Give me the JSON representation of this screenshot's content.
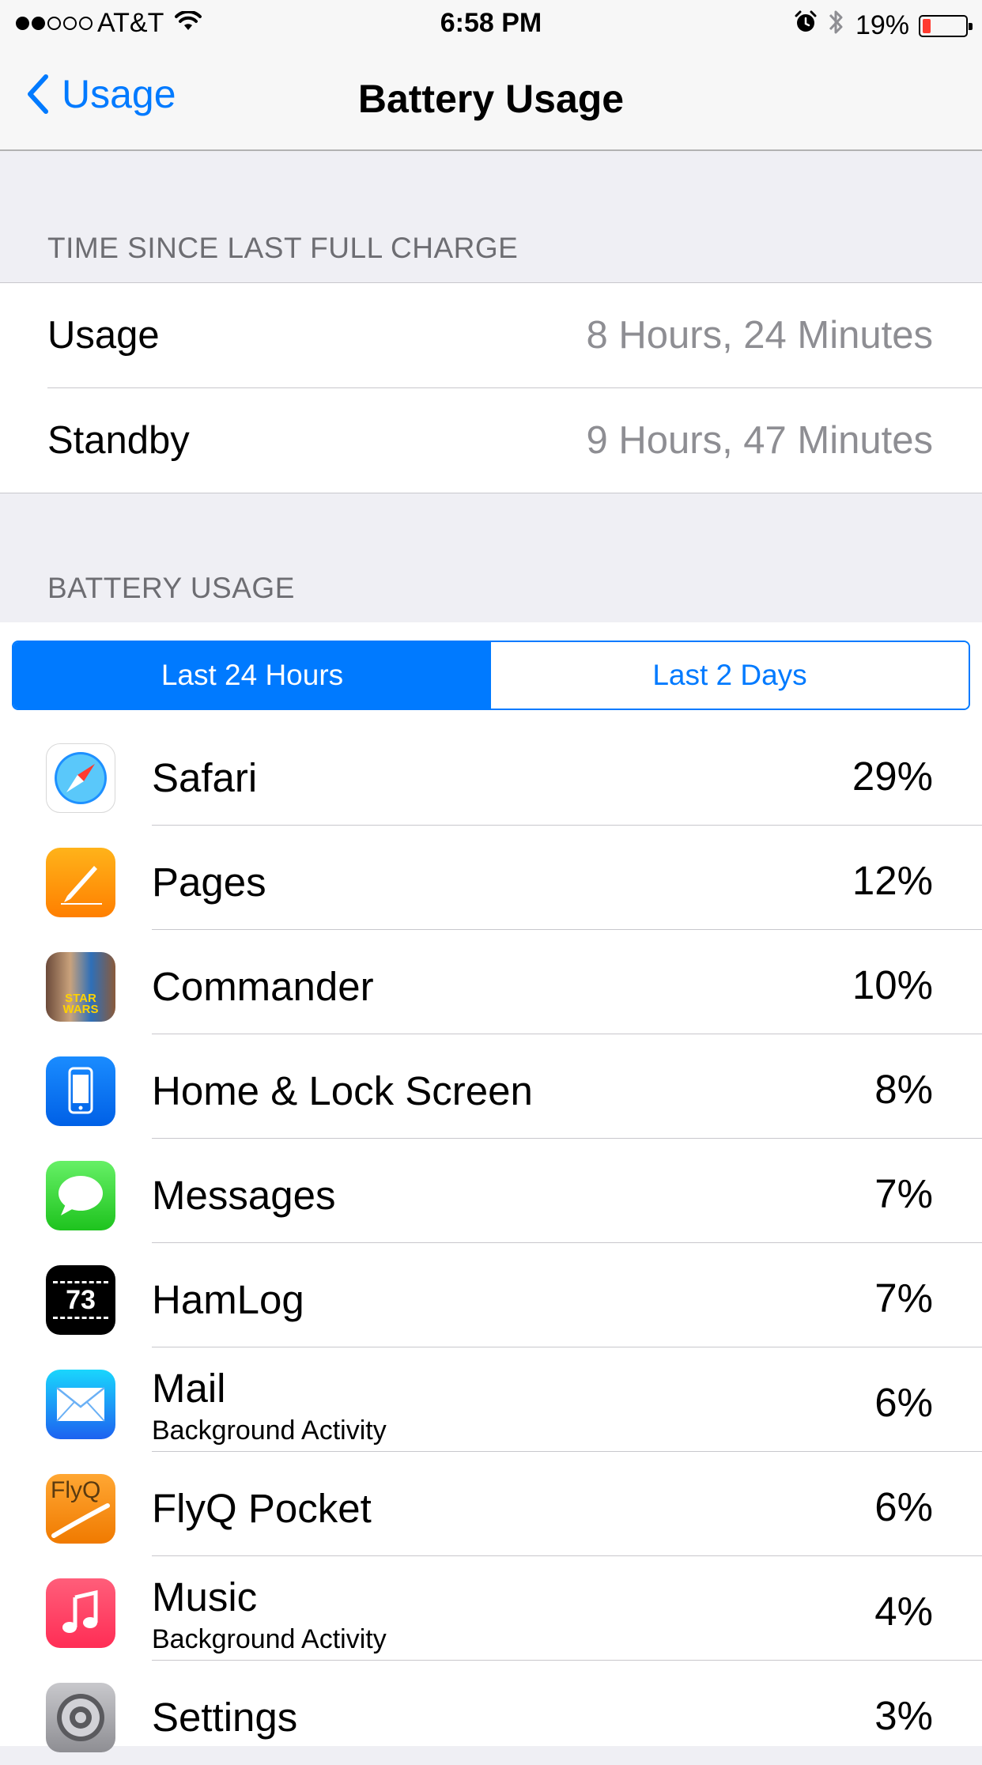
{
  "status_bar": {
    "signal": "●●○○○",
    "carrier": "AT&T",
    "time": "6:58 PM",
    "battery_percent": "19%",
    "icons": [
      "wifi-icon",
      "alarm-icon",
      "bluetooth-icon",
      "battery-icon"
    ]
  },
  "nav": {
    "back_label": "Usage",
    "title": "Battery Usage"
  },
  "time_section": {
    "header": "TIME SINCE LAST FULL CHARGE",
    "rows": [
      {
        "label": "Usage",
        "value": "8 Hours, 24 Minutes"
      },
      {
        "label": "Standby",
        "value": "9 Hours, 47 Minutes"
      }
    ]
  },
  "usage_section": {
    "header": "BATTERY USAGE",
    "segments": [
      "Last 24 Hours",
      "Last 2 Days"
    ],
    "selected_segment": "Last 24 Hours",
    "apps": [
      {
        "name": "Safari",
        "sub": "",
        "percent": "29%",
        "icon": "safari-icon"
      },
      {
        "name": "Pages",
        "sub": "",
        "percent": "12%",
        "icon": "pages-icon"
      },
      {
        "name": "Commander",
        "sub": "",
        "percent": "10%",
        "icon": "commander-icon"
      },
      {
        "name": "Home & Lock Screen",
        "sub": "",
        "percent": "8%",
        "icon": "home-lock-screen-icon"
      },
      {
        "name": "Messages",
        "sub": "",
        "percent": "7%",
        "icon": "messages-icon"
      },
      {
        "name": "HamLog",
        "sub": "",
        "percent": "7%",
        "icon": "hamlog-icon"
      },
      {
        "name": "Mail",
        "sub": "Background Activity",
        "percent": "6%",
        "icon": "mail-icon"
      },
      {
        "name": "FlyQ Pocket",
        "sub": "",
        "percent": "6%",
        "icon": "flyq-pocket-icon"
      },
      {
        "name": "Music",
        "sub": "Background Activity",
        "percent": "4%",
        "icon": "music-icon"
      },
      {
        "name": "Settings",
        "sub": "",
        "percent": "3%",
        "icon": "settings-icon"
      }
    ],
    "icon_text": {
      "hamlog": "73",
      "flyq": "FlyQ",
      "commander": "STAR WARS"
    }
  },
  "colors": {
    "accent": "#007aff",
    "background": "#efeff4",
    "secondary_text": "#8e8e93",
    "header_text": "#6d6d72",
    "battery_low": "#ff3b30"
  }
}
